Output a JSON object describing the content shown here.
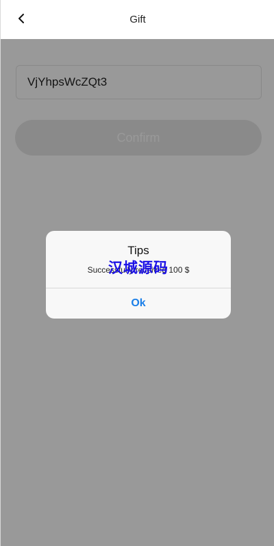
{
  "navbar": {
    "title": "Gift",
    "back_icon": "chevron-left-icon"
  },
  "form": {
    "code_value": "VjYhpsWcZQt3",
    "confirm_label": "Confirm"
  },
  "dialog": {
    "title": "Tips",
    "message": "Successfully received 100 $",
    "watermark": "汉城源码",
    "ok_label": "Ok"
  },
  "colors": {
    "accent": "#1b7fe8",
    "watermark": "#1a10e6",
    "overlay": "rgba(0,0,0,0.40)"
  }
}
